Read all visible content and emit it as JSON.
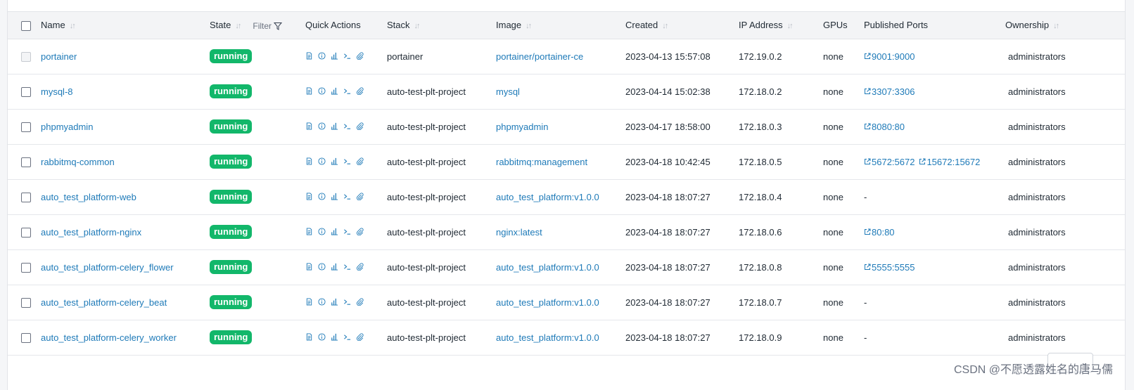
{
  "table": {
    "columns": [
      {
        "key": "name",
        "label": "Name",
        "sortable": true
      },
      {
        "key": "state",
        "label": "State",
        "sortable": true
      },
      {
        "key": "quick_actions",
        "label": "Quick Actions",
        "sortable": false
      },
      {
        "key": "stack",
        "label": "Stack",
        "sortable": true
      },
      {
        "key": "image",
        "label": "Image",
        "sortable": true
      },
      {
        "key": "created",
        "label": "Created",
        "sortable": true
      },
      {
        "key": "ip",
        "label": "IP Address",
        "sortable": true
      },
      {
        "key": "gpus",
        "label": "GPUs",
        "sortable": false
      },
      {
        "key": "ports",
        "label": "Published Ports",
        "sortable": false
      },
      {
        "key": "ownership",
        "label": "Ownership",
        "sortable": true
      }
    ],
    "filter_label": "Filter",
    "quick_action_icons": [
      "logs-icon",
      "inspect-icon",
      "stats-icon",
      "console-icon",
      "attach-icon"
    ],
    "rows": [
      {
        "name": "portainer",
        "state": "running",
        "stack": "portainer",
        "image": "portainer/portainer-ce",
        "created": "2023-04-13 15:57:08",
        "ip": "172.19.0.2",
        "gpus": "none",
        "ports": [
          "9001:9000"
        ],
        "ownership": "administrators",
        "checkbox_disabled": true
      },
      {
        "name": "mysql-8",
        "state": "running",
        "stack": "auto-test-plt-project",
        "image": "mysql",
        "created": "2023-04-14 15:02:38",
        "ip": "172.18.0.2",
        "gpus": "none",
        "ports": [
          "3307:3306"
        ],
        "ownership": "administrators"
      },
      {
        "name": "phpmyadmin",
        "state": "running",
        "stack": "auto-test-plt-project",
        "image": "phpmyadmin",
        "created": "2023-04-17 18:58:00",
        "ip": "172.18.0.3",
        "gpus": "none",
        "ports": [
          "8080:80"
        ],
        "ownership": "administrators"
      },
      {
        "name": "rabbitmq-common",
        "state": "running",
        "stack": "auto-test-plt-project",
        "image": "rabbitmq:management",
        "created": "2023-04-18 10:42:45",
        "ip": "172.18.0.5",
        "gpus": "none",
        "ports": [
          "5672:5672",
          "15672:15672"
        ],
        "ownership": "administrators"
      },
      {
        "name": "auto_test_platform-web",
        "state": "running",
        "stack": "auto-test-plt-project",
        "image": "auto_test_platform:v1.0.0",
        "created": "2023-04-18 18:07:27",
        "ip": "172.18.0.4",
        "gpus": "none",
        "ports": [],
        "ports_empty": "-",
        "ownership": "administrators"
      },
      {
        "name": "auto_test_platform-nginx",
        "state": "running",
        "stack": "auto-test-plt-project",
        "image": "nginx:latest",
        "created": "2023-04-18 18:07:27",
        "ip": "172.18.0.6",
        "gpus": "none",
        "ports": [
          "80:80"
        ],
        "ownership": "administrators"
      },
      {
        "name": "auto_test_platform-celery_flower",
        "state": "running",
        "stack": "auto-test-plt-project",
        "image": "auto_test_platform:v1.0.0",
        "created": "2023-04-18 18:07:27",
        "ip": "172.18.0.8",
        "gpus": "none",
        "ports": [
          "5555:5555"
        ],
        "ownership": "administrators"
      },
      {
        "name": "auto_test_platform-celery_beat",
        "state": "running",
        "stack": "auto-test-plt-project",
        "image": "auto_test_platform:v1.0.0",
        "created": "2023-04-18 18:07:27",
        "ip": "172.18.0.7",
        "gpus": "none",
        "ports": [],
        "ports_empty": "-",
        "ownership": "administrators"
      },
      {
        "name": "auto_test_platform-celery_worker",
        "state": "running",
        "stack": "auto-test-plt-project",
        "image": "auto_test_platform:v1.0.0",
        "created": "2023-04-18 18:07:27",
        "ip": "172.18.0.9",
        "gpus": "none",
        "ports": [],
        "ports_empty": "-",
        "ownership": "administrators"
      }
    ]
  },
  "watermark": "CSDN @不愿透露姓名的唐马儒",
  "colors": {
    "running_badge": "#12b76a",
    "link": "#1e7ab8"
  }
}
